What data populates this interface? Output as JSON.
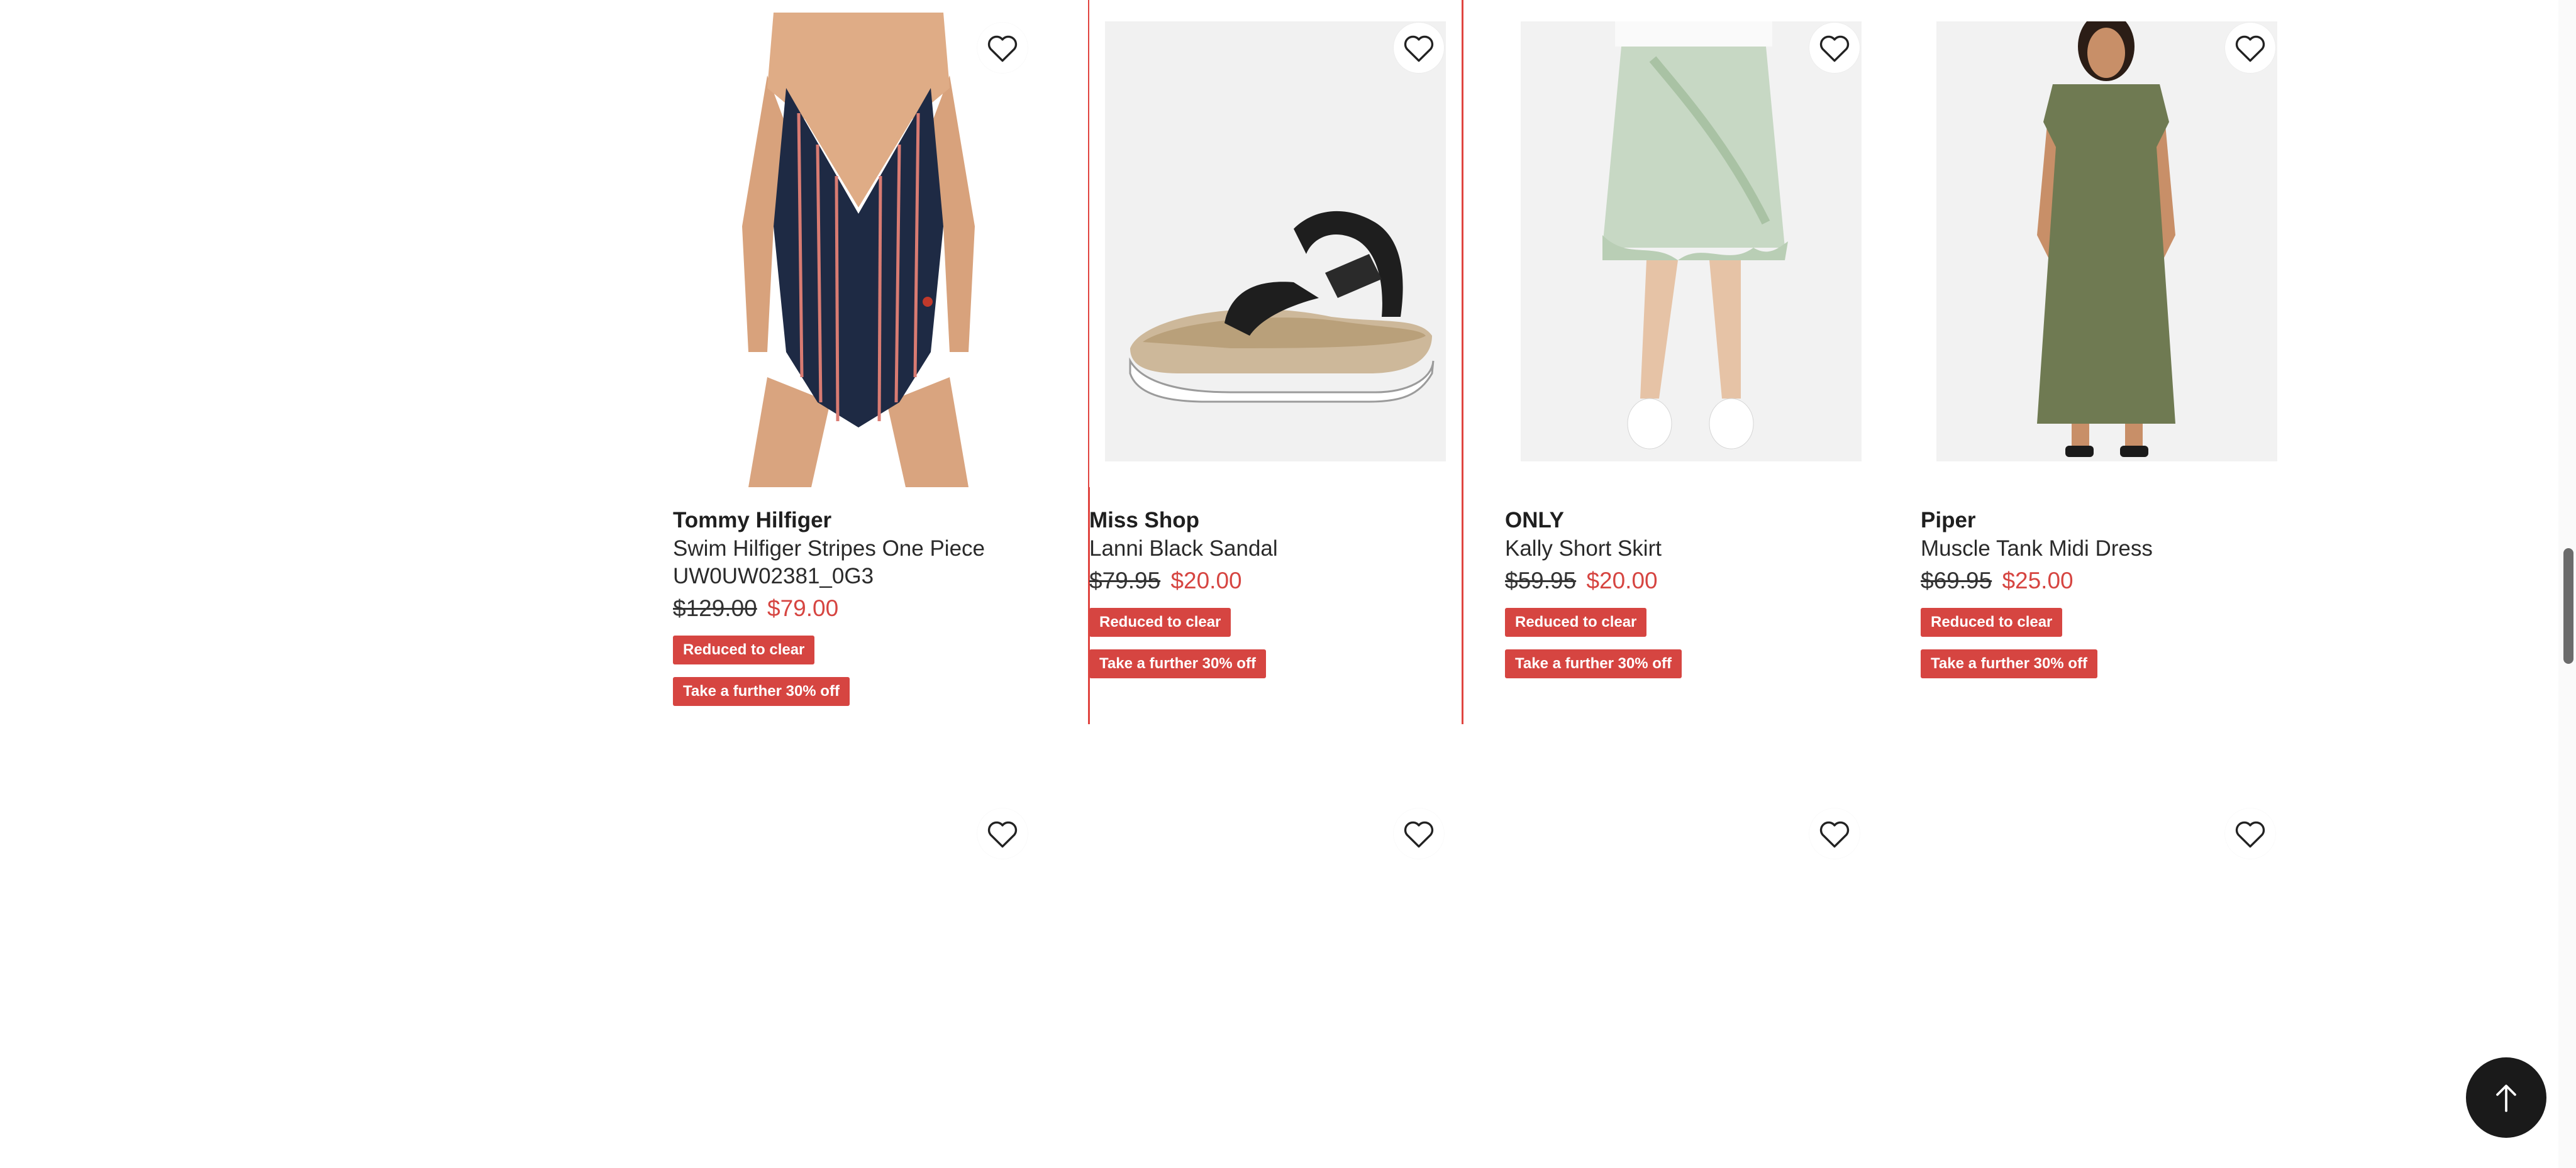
{
  "products": [
    {
      "brand": "Tommy Hilfiger",
      "name": "Swim Hilfiger Stripes One Piece UW0UW02381_0G3",
      "was_price": "$129.00",
      "now_price": "$79.00",
      "badges": [
        "Reduced to clear",
        "Take a further 30% off"
      ],
      "image": "striped-one-piece-swimsuit",
      "wishlist_icon": "heart-outline-icon"
    },
    {
      "brand": "Miss Shop",
      "name": "Lanni Black Sandal",
      "was_price": "$79.95",
      "now_price": "$20.00",
      "badges": [
        "Reduced to clear",
        "Take a further 30% off"
      ],
      "image": "black-sandal",
      "wishlist_icon": "heart-outline-icon"
    },
    {
      "brand": "ONLY",
      "name": "Kally Short Skirt",
      "was_price": "$59.95",
      "now_price": "$20.00",
      "badges": [
        "Reduced to clear",
        "Take a further 30% off"
      ],
      "image": "green-gingham-ruffle-skirt",
      "wishlist_icon": "heart-outline-icon"
    },
    {
      "brand": "Piper",
      "name": "Muscle Tank Midi Dress",
      "was_price": "$69.95",
      "now_price": "$25.00",
      "badges": [
        "Reduced to clear",
        "Take a further 30% off"
      ],
      "image": "olive-midi-dress",
      "wishlist_icon": "heart-outline-icon"
    }
  ],
  "next_row": {
    "wishlist_icons": [
      "heart-outline-icon",
      "heart-outline-icon",
      "heart-outline-icon",
      "heart-outline-icon"
    ]
  },
  "back_to_top": {
    "icon": "arrow-up-icon"
  },
  "colors": {
    "sale_red": "#d64541",
    "focus_outline": "#e0443f",
    "back_to_top_bg": "#1a1a1a"
  }
}
